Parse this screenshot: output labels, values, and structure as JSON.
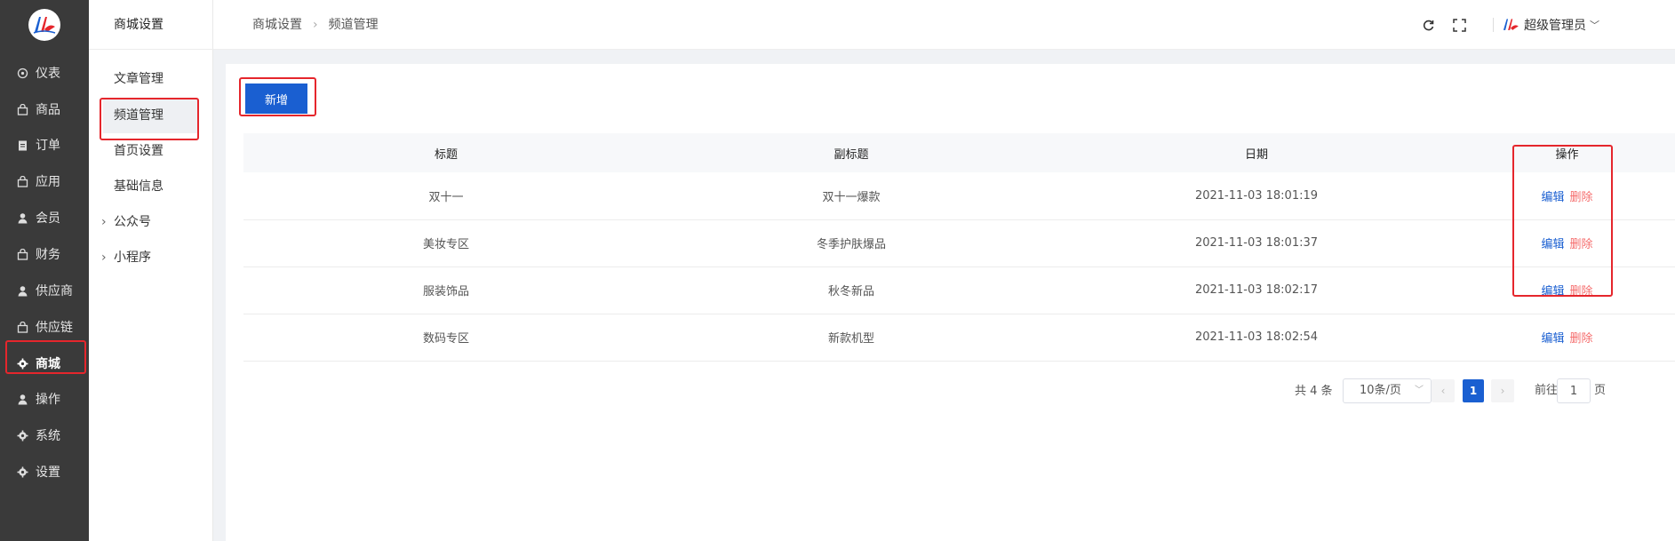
{
  "sidebar": {
    "items": [
      {
        "label": "仪表",
        "icon": "dashboard-icon"
      },
      {
        "label": "商品",
        "icon": "bag-icon"
      },
      {
        "label": "订单",
        "icon": "clipboard-icon"
      },
      {
        "label": "应用",
        "icon": "bag-icon"
      },
      {
        "label": "会员",
        "icon": "user-icon"
      },
      {
        "label": "财务",
        "icon": "bag-icon"
      },
      {
        "label": "供应商",
        "icon": "user-icon"
      },
      {
        "label": "供应链",
        "icon": "bag-icon"
      },
      {
        "label": "商城",
        "icon": "gear-icon",
        "active": true
      },
      {
        "label": "操作",
        "icon": "user-icon"
      },
      {
        "label": "系统",
        "icon": "gear-icon"
      },
      {
        "label": "设置",
        "icon": "gear-icon"
      }
    ]
  },
  "subbar": {
    "title": "商城设置",
    "items": [
      {
        "label": "文章管理"
      },
      {
        "label": "频道管理",
        "active": true
      },
      {
        "label": "首页设置"
      },
      {
        "label": "基础信息"
      },
      {
        "label": "公众号",
        "group": true
      },
      {
        "label": "小程序",
        "group": true
      }
    ]
  },
  "header": {
    "breadcrumb": [
      "商城设置",
      "频道管理"
    ],
    "user": "超级管理员"
  },
  "toolbar": {
    "add_label": "新增"
  },
  "table": {
    "columns": [
      "标题",
      "副标题",
      "日期",
      "操作"
    ],
    "rows": [
      {
        "title": "双十一",
        "subtitle": "双十一爆款",
        "date": "2021-11-03 18:01:19",
        "edit": "编辑",
        "delete": "删除"
      },
      {
        "title": "美妆专区",
        "subtitle": "冬季护肤爆品",
        "date": "2021-11-03 18:01:37",
        "edit": "编辑",
        "delete": "删除"
      },
      {
        "title": "服装饰品",
        "subtitle": "秋冬新品",
        "date": "2021-11-03 18:02:17",
        "edit": "编辑",
        "delete": "删除"
      },
      {
        "title": "数码专区",
        "subtitle": "新款机型",
        "date": "2021-11-03 18:02:54",
        "edit": "编辑",
        "delete": "删除"
      }
    ]
  },
  "pagination": {
    "total": "共 4 条",
    "page_size": "10条/页",
    "current_page": "1",
    "goto_label": "前往",
    "goto_value": "1",
    "goto_unit": "页"
  },
  "colors": {
    "sidebar_bg": "#3a3a3a",
    "primary": "#1a5fd1",
    "danger": "#f56c6c",
    "highlight_box": "#e5262c"
  }
}
